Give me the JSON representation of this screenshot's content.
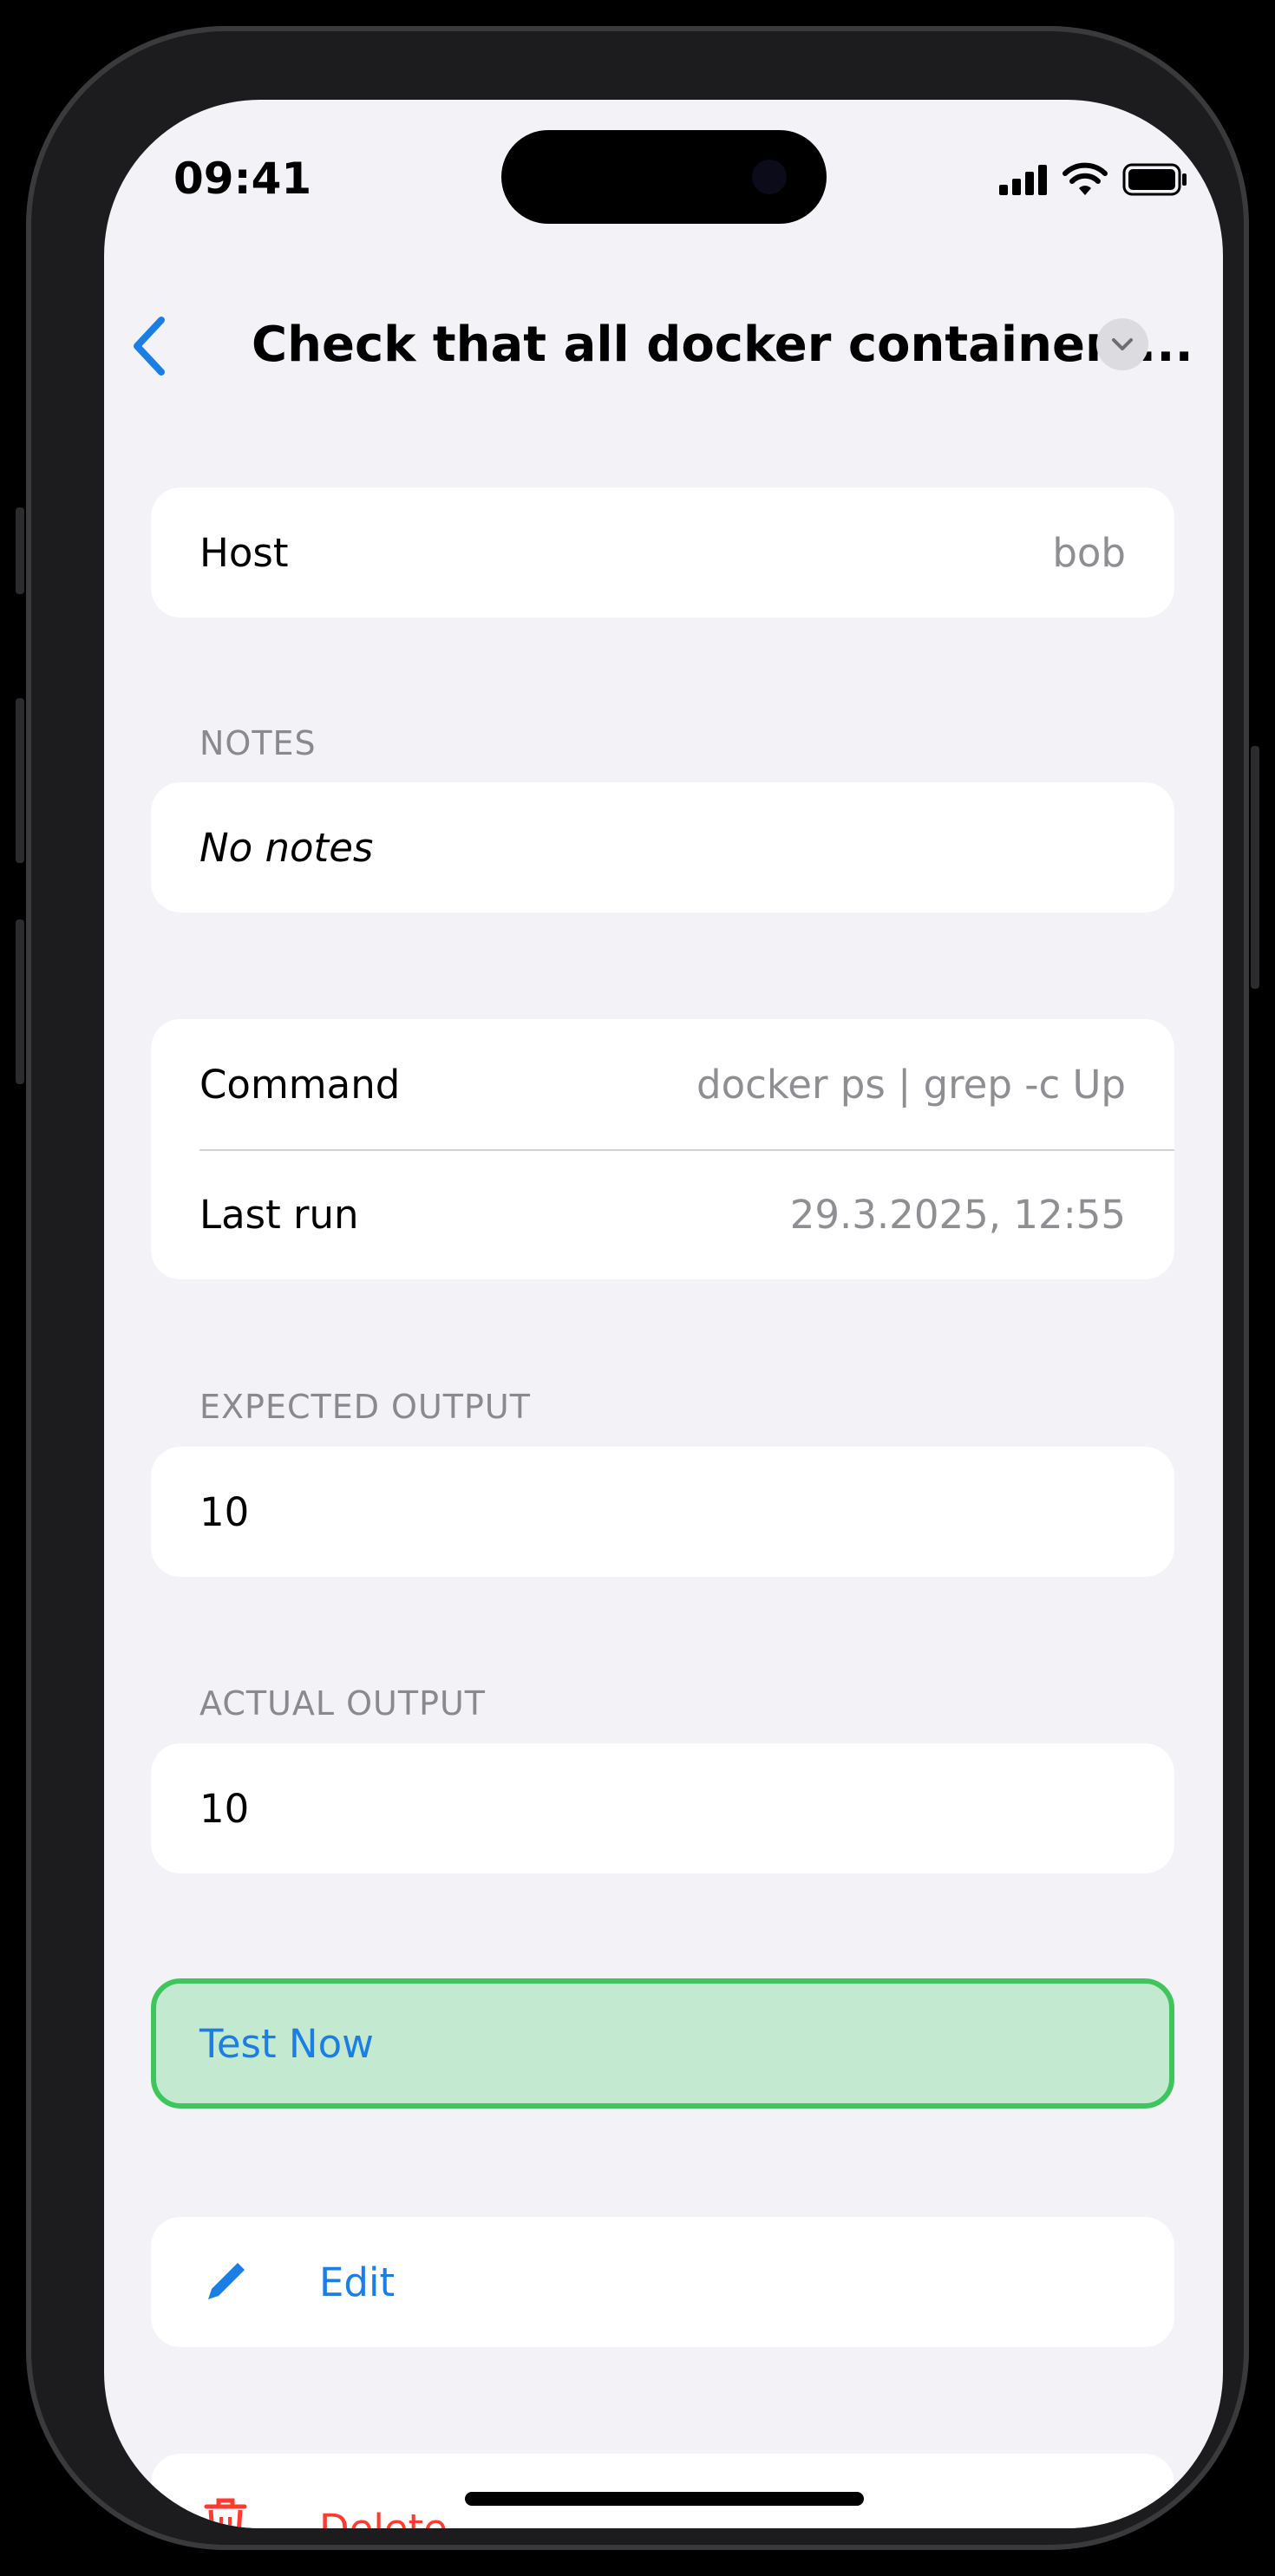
{
  "status_bar": {
    "time": "09:41"
  },
  "nav": {
    "title": "Check that all docker containers..."
  },
  "host": {
    "label": "Host",
    "value": "bob"
  },
  "notes": {
    "header": "NOTES",
    "value": "No notes"
  },
  "details": {
    "command_label": "Command",
    "command_value": "docker ps | grep -c Up",
    "last_run_label": "Last run",
    "last_run_value": "29.3.2025, 12:55"
  },
  "expected_output": {
    "header": "EXPECTED OUTPUT",
    "value": "10"
  },
  "actual_output": {
    "header": "ACTUAL OUTPUT",
    "value": "10"
  },
  "actions": {
    "test_now": "Test Now",
    "edit": "Edit",
    "delete": "Delete"
  },
  "colors": {
    "accent": "#1a7ee6",
    "success_border": "#3ec55c",
    "success_fill": "#c3ead0",
    "destructive": "#ff3b30",
    "background": "#f2f2f7"
  },
  "icons": {
    "back": "chevron-left-icon",
    "title_menu": "chevron-down-icon",
    "edit": "pencil-icon",
    "delete": "trash-icon",
    "signal": "cellular-signal-icon",
    "wifi": "wifi-icon",
    "battery": "battery-icon"
  }
}
